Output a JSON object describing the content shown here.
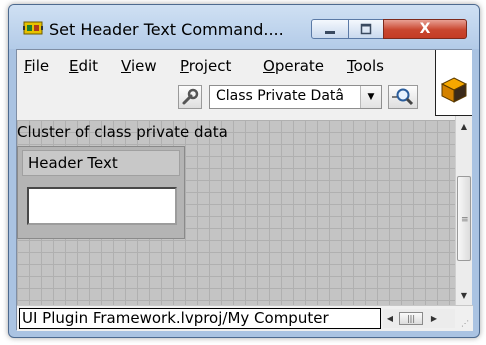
{
  "window": {
    "title": "Set Header Text Command....",
    "icon": "labview-vi-icon",
    "controls": {
      "minimize_icon": "minimize-icon",
      "maximize_icon": "maximize-icon",
      "close_icon": "close-icon",
      "close_glyph": "X"
    }
  },
  "menubar": {
    "items": [
      {
        "mnemonic": "F",
        "rest": "ile"
      },
      {
        "mnemonic": "E",
        "rest": "dit"
      },
      {
        "mnemonic": "V",
        "rest": "iew"
      },
      {
        "mnemonic": "P",
        "rest": "roject"
      },
      {
        "mnemonic": "O",
        "rest": "perate"
      },
      {
        "mnemonic": "T",
        "rest": "ools"
      }
    ]
  },
  "toolbar": {
    "properties_icon": "wrench-icon",
    "context": {
      "selected": "Class Private Datâ"
    },
    "find_icon": "magnifier-icon"
  },
  "panel": {
    "cluster_label": "Cluster of class private data",
    "header_text_label": "Header Text",
    "header_text_value": ""
  },
  "statusbar": {
    "path": "UI Plugin Framework.lvproj/My Computer"
  },
  "colors": {
    "title_bar": "#b3cbe8",
    "close_button": "#c43c25",
    "panel_grid": "#c4c4c4",
    "chrome": "#f0f0f0"
  }
}
